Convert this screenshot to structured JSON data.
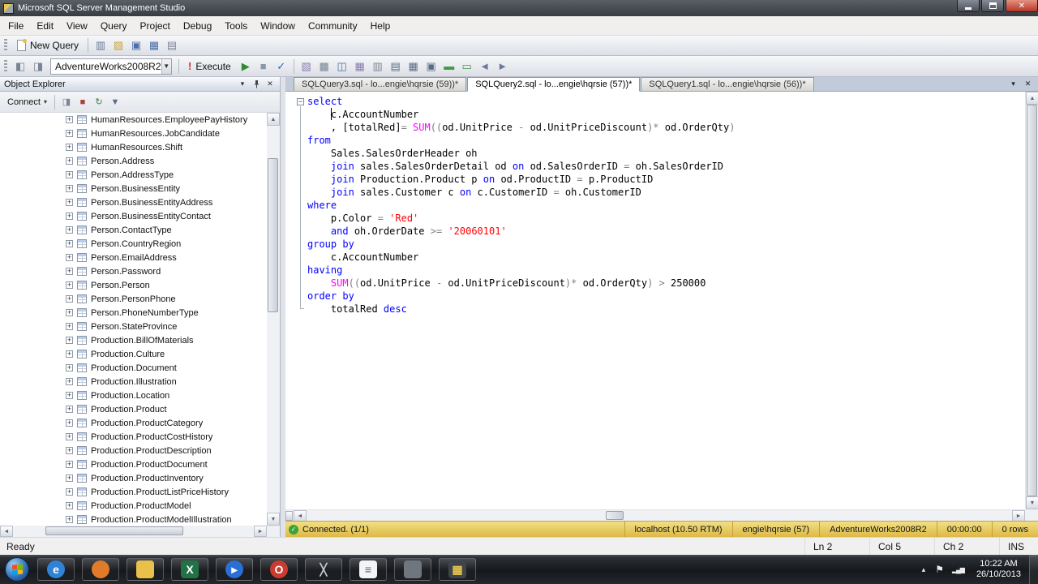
{
  "window": {
    "title": "Microsoft SQL Server Management Studio",
    "menu_items": [
      "File",
      "Edit",
      "View",
      "Query",
      "Project",
      "Debug",
      "Tools",
      "Window",
      "Community",
      "Help"
    ]
  },
  "toolbar": {
    "new_query_label": "New Query",
    "database_combo": "AdventureWorks2008R2",
    "execute_label": "Execute",
    "std_icons": [
      {
        "name": "new-database-query-icon",
        "glyph": "▥",
        "color": "#6b7c9a"
      },
      {
        "name": "open-file-icon",
        "glyph": "▨",
        "color": "#c9a23d"
      },
      {
        "name": "save-icon",
        "glyph": "▣",
        "color": "#4a6ea9"
      },
      {
        "name": "save-all-icon",
        "glyph": "▦",
        "color": "#4a6ea9"
      },
      {
        "name": "print-icon",
        "glyph": "▤",
        "color": "#7c8698"
      }
    ],
    "conn_icons": [
      {
        "name": "connect-icon",
        "glyph": "◧",
        "color": "#7a8494"
      },
      {
        "name": "change-connection-icon",
        "glyph": "◨",
        "color": "#7a8494"
      }
    ],
    "exec_icons": [
      {
        "name": "debug-icon",
        "glyph": "▶",
        "color": "#2e8b2e"
      },
      {
        "name": "stop-icon",
        "glyph": "■",
        "color": "#8b98a8"
      },
      {
        "name": "parse-icon",
        "glyph": "✓",
        "color": "#2f62b8"
      }
    ],
    "query_icons": [
      {
        "name": "estimated-plan-icon",
        "glyph": "▧",
        "color": "#8a7cb0"
      },
      {
        "name": "query-options-icon",
        "glyph": "▩",
        "color": "#7a8494"
      },
      {
        "name": "intellisense-icon",
        "glyph": "◫",
        "color": "#4a6ea9"
      },
      {
        "name": "actual-plan-icon",
        "glyph": "▦",
        "color": "#8a7cb0"
      },
      {
        "name": "client-statistics-icon",
        "glyph": "▥",
        "color": "#7a8494"
      },
      {
        "name": "results-to-text-icon",
        "glyph": "▤",
        "color": "#5b6b85"
      },
      {
        "name": "results-to-grid-icon",
        "glyph": "▦",
        "color": "#5b6b85"
      },
      {
        "name": "results-to-file-icon",
        "glyph": "▣",
        "color": "#5b6b85"
      },
      {
        "name": "comment-icon",
        "glyph": "▬",
        "color": "#3f9b3f"
      },
      {
        "name": "uncomment-icon",
        "glyph": "▭",
        "color": "#3f9b3f"
      },
      {
        "name": "decrease-indent-icon",
        "glyph": "◄",
        "color": "#6b7c9a"
      },
      {
        "name": "increase-indent-icon",
        "glyph": "►",
        "color": "#6b7c9a"
      }
    ]
  },
  "object_explorer": {
    "title": "Object Explorer",
    "connect_label": "Connect",
    "toolbar_icons": [
      {
        "name": "disconnect-icon",
        "glyph": "◨",
        "color": "#7a8494"
      },
      {
        "name": "stop-icon",
        "glyph": "■",
        "color": "#a84238"
      },
      {
        "name": "refresh-icon",
        "glyph": "↻",
        "color": "#3f7c3f"
      },
      {
        "name": "filter-icon",
        "glyph": "▼",
        "color": "#5b6b85"
      }
    ],
    "items": [
      "HumanResources.EmployeePayHistory",
      "HumanResources.JobCandidate",
      "HumanResources.Shift",
      "Person.Address",
      "Person.AddressType",
      "Person.BusinessEntity",
      "Person.BusinessEntityAddress",
      "Person.BusinessEntityContact",
      "Person.ContactType",
      "Person.CountryRegion",
      "Person.EmailAddress",
      "Person.Password",
      "Person.Person",
      "Person.PersonPhone",
      "Person.PhoneNumberType",
      "Person.StateProvince",
      "Production.BillOfMaterials",
      "Production.Culture",
      "Production.Document",
      "Production.Illustration",
      "Production.Location",
      "Production.Product",
      "Production.ProductCategory",
      "Production.ProductCostHistory",
      "Production.ProductDescription",
      "Production.ProductDocument",
      "Production.ProductInventory",
      "Production.ProductListPriceHistory",
      "Production.ProductModel",
      "Production.ProductModelIllustration"
    ]
  },
  "tabs": [
    {
      "label": "SQLQuery3.sql - lo...engie\\hqrsie (59))*",
      "active": false
    },
    {
      "label": "SQLQuery2.sql - lo...engie\\hqrsie (57))*",
      "active": true
    },
    {
      "label": "SQLQuery1.sql - lo...engie\\hqrsie (56))*",
      "active": false
    }
  ],
  "editor": {
    "lines": [
      [
        [
          "k",
          "select"
        ]
      ],
      [
        [
          "i",
          "    c.AccountNumber"
        ]
      ],
      [
        [
          "i",
          "    , [totalRed]"
        ],
        [
          "o",
          "= "
        ],
        [
          "f",
          "SUM"
        ],
        [
          "o",
          "(("
        ],
        [
          "i",
          "od.UnitPrice "
        ],
        [
          "o",
          "- "
        ],
        [
          "i",
          "od.UnitPriceDiscount"
        ],
        [
          "o",
          ")* "
        ],
        [
          "i",
          "od.OrderQty"
        ],
        [
          "o",
          ")"
        ]
      ],
      [
        [
          "k",
          "from"
        ]
      ],
      [
        [
          "i",
          "    Sales.SalesOrderHeader oh"
        ]
      ],
      [
        [
          "i",
          "    "
        ],
        [
          "k",
          "join"
        ],
        [
          "i",
          " sales.SalesOrderDetail od "
        ],
        [
          "k",
          "on"
        ],
        [
          "i",
          " od.SalesOrderID "
        ],
        [
          "o",
          "= "
        ],
        [
          "i",
          "oh.SalesOrderID"
        ]
      ],
      [
        [
          "i",
          "    "
        ],
        [
          "k",
          "join"
        ],
        [
          "i",
          " Production.Product p "
        ],
        [
          "k",
          "on"
        ],
        [
          "i",
          " od.ProductID "
        ],
        [
          "o",
          "= "
        ],
        [
          "i",
          "p.ProductID"
        ]
      ],
      [
        [
          "i",
          "    "
        ],
        [
          "k",
          "join"
        ],
        [
          "i",
          " sales.Customer c "
        ],
        [
          "k",
          "on"
        ],
        [
          "i",
          " c.CustomerID "
        ],
        [
          "o",
          "= "
        ],
        [
          "i",
          "oh.CustomerID"
        ]
      ],
      [
        [
          "k",
          "where"
        ]
      ],
      [
        [
          "i",
          "    p.Color "
        ],
        [
          "o",
          "= "
        ],
        [
          "s",
          "'Red'"
        ]
      ],
      [
        [
          "i",
          "    "
        ],
        [
          "k",
          "and"
        ],
        [
          "i",
          " oh.OrderDate "
        ],
        [
          "o",
          ">= "
        ],
        [
          "s",
          "'20060101'"
        ]
      ],
      [
        [
          "k",
          "group by"
        ]
      ],
      [
        [
          "i",
          "    c.AccountNumber"
        ]
      ],
      [
        [
          "k",
          "having"
        ]
      ],
      [
        [
          "i",
          "    "
        ],
        [
          "f",
          "SUM"
        ],
        [
          "o",
          "(("
        ],
        [
          "i",
          "od.UnitPrice "
        ],
        [
          "o",
          "- "
        ],
        [
          "i",
          "od.UnitPriceDiscount"
        ],
        [
          "o",
          ")* "
        ],
        [
          "i",
          "od.OrderQty"
        ],
        [
          "o",
          ") > "
        ],
        [
          "i",
          "250000"
        ]
      ],
      [
        [
          "k",
          "order by"
        ]
      ],
      [
        [
          "i",
          "    totalRed "
        ],
        [
          "k",
          "desc"
        ]
      ]
    ]
  },
  "query_status": {
    "connected": "Connected. (1/1)",
    "server": "localhost (10.50 RTM)",
    "user": "engie\\hqrsie (57)",
    "database": "AdventureWorks2008R2",
    "time": "00:00:00",
    "rows": "0 rows"
  },
  "status_bar": {
    "state": "Ready",
    "ln": "Ln 2",
    "col": "Col 5",
    "ch": "Ch 2",
    "mode": "INS"
  },
  "taskbar": {
    "clock_time": "10:22 AM",
    "clock_date": "26/10/2013",
    "icons": [
      {
        "name": "internet-explorer-icon",
        "glyph": "e",
        "bg": "#2f83d6",
        "fg": "#ffffff",
        "shape": "circle"
      },
      {
        "name": "firefox-icon",
        "glyph": "",
        "bg": "#e07b2a",
        "fg": "#ffffff",
        "shape": "circle"
      },
      {
        "name": "folder-icon",
        "glyph": "",
        "bg": "#e9c04a",
        "fg": "#a8821e",
        "shape": "rect"
      },
      {
        "name": "excel-icon",
        "glyph": "X",
        "bg": "#217346",
        "fg": "#ffffff",
        "shape": "rect"
      },
      {
        "name": "media-player-icon",
        "glyph": "▸",
        "bg": "#2a6fd6",
        "fg": "#ffffff",
        "shape": "circle"
      },
      {
        "name": "opera-icon",
        "glyph": "O",
        "bg": "#cc3b2f",
        "fg": "#ffffff",
        "shape": "circle"
      },
      {
        "name": "tools-icon",
        "glyph": "╳",
        "bg": "transparent",
        "fg": "#c8cdd4",
        "shape": "rect"
      },
      {
        "name": "notepad-icon",
        "glyph": "≡",
        "bg": "#f2f4f6",
        "fg": "#55627a",
        "shape": "rect"
      },
      {
        "name": "app-window-icon",
        "glyph": "",
        "bg": "#70767e",
        "fg": "#ffffff",
        "shape": "rect"
      },
      {
        "name": "ssms-icon",
        "glyph": "▦",
        "bg": "#3f444c",
        "fg": "#e3c34d",
        "shape": "rect"
      }
    ]
  },
  "colors": {
    "keyword": "#0000ff",
    "identifier": "#000000",
    "operator": "#808080",
    "string": "#ff0000",
    "function": "#ff00ff",
    "status_gold": "#e0bd4a",
    "close_red": "#c0392b"
  }
}
